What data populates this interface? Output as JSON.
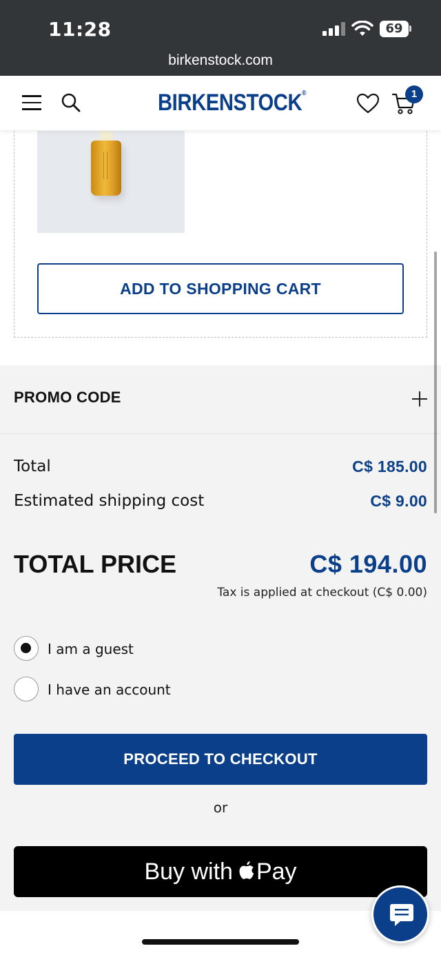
{
  "status_bar": {
    "time": "11:28",
    "battery": "69",
    "url": "birkenstock.com"
  },
  "header": {
    "brand": "BIRKENSTOCK",
    "cart_count": "1",
    "icons": [
      "menu-icon",
      "search-icon",
      "heart-icon",
      "cart-icon"
    ]
  },
  "product": {
    "add_to_cart_label": "ADD TO SHOPPING CART"
  },
  "promo": {
    "label": "PROMO CODE"
  },
  "summary": {
    "total_label": "Total",
    "total_value": "C$ 185.00",
    "shipping_label": "Estimated shipping cost",
    "shipping_value": "C$ 9.00",
    "total_price_label": "TOTAL PRICE",
    "total_price_value": "C$ 194.00",
    "tax_note": "Tax is applied at checkout  (C$ 0.00)"
  },
  "account_options": [
    {
      "label": "I am a guest",
      "selected": true
    },
    {
      "label": "I have an account",
      "selected": false
    }
  ],
  "checkout": {
    "proceed_label": "PROCEED TO CHECKOUT",
    "or_label": "or",
    "applepay_prefix": "Buy with",
    "applepay_suffix": "Pay"
  },
  "colors": {
    "brand_blue": "#0b3f8a",
    "status_bar_bg": "#333638",
    "summary_bg": "#f3f3f3"
  }
}
